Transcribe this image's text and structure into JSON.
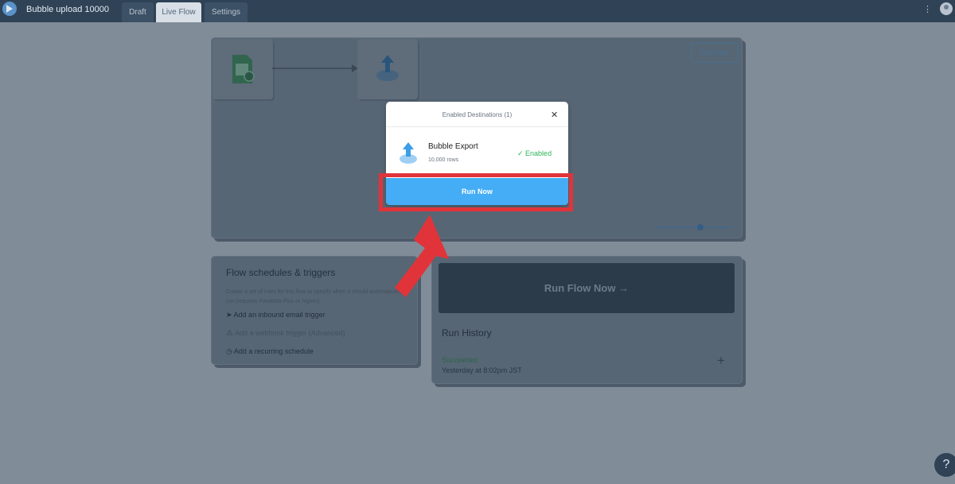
{
  "header": {
    "app_title": "Bubble upload 10000",
    "tabs": [
      {
        "label": "Draft"
      },
      {
        "label": "Live Flow"
      },
      {
        "label": "Settings"
      }
    ],
    "menu_glyph": "⋮"
  },
  "canvas": {
    "edit_flow_label": "Edit Flow"
  },
  "schedules": {
    "title": "Flow schedules & triggers",
    "description": "Create a set of rules for this flow to specify when it should automatically run (requires Parabola Plus or higher).",
    "items": [
      {
        "label": "Add an inbound email trigger",
        "icon": "send-icon"
      },
      {
        "label": "Add a webhook trigger (Advanced)",
        "icon": "webhook-icon"
      },
      {
        "label": "Add a recurring schedule",
        "icon": "clock-icon"
      }
    ]
  },
  "run_panel": {
    "run_flow_label": "Run Flow Now →",
    "history_title": "Run History",
    "last_status": "Succeeded",
    "last_time": "Yesterday at 8:02pm JST",
    "add_glyph": "+"
  },
  "modal": {
    "title": "Enabled Destinations (1)",
    "close_glyph": "✕",
    "destination": {
      "name": "Bubble Export",
      "rows": "10,000 rows",
      "status": "✓ Enabled"
    },
    "run_now_label": "Run Now"
  },
  "help_glyph": "?",
  "colors": {
    "accent": "#44adf5",
    "highlight": "#e0343a",
    "enabled": "#2fb35a"
  }
}
